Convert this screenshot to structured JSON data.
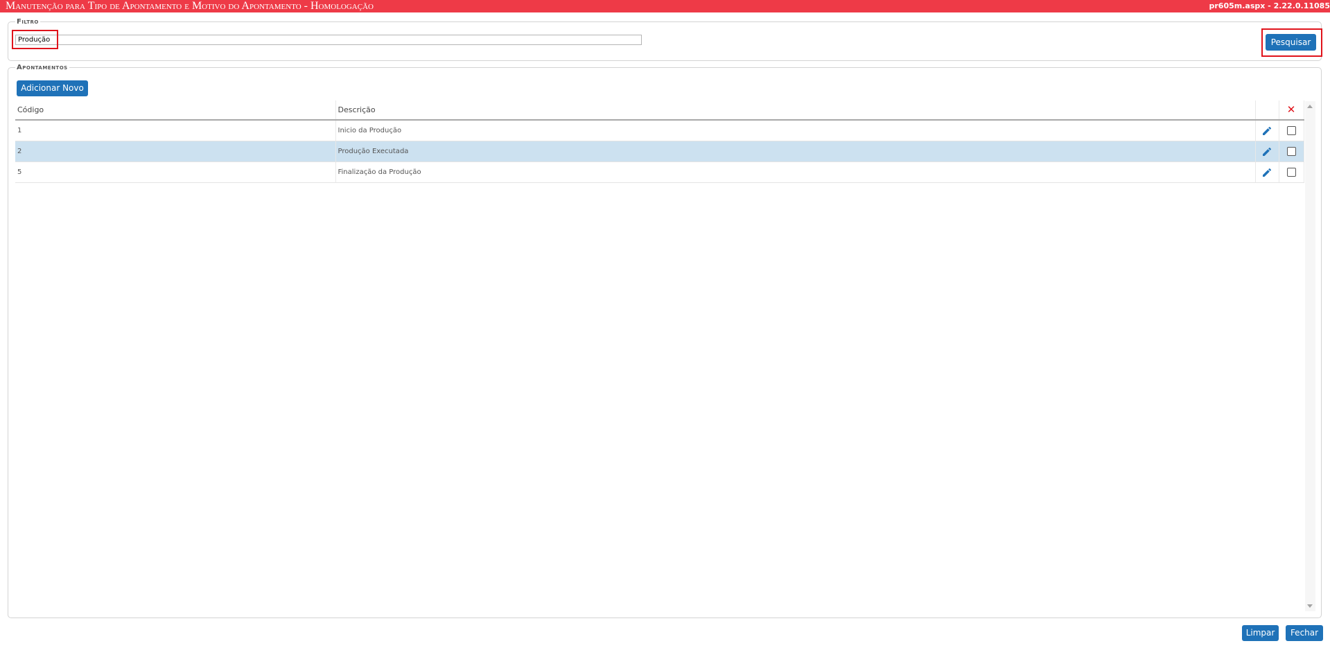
{
  "header": {
    "title": "Manutenção para Tipo de Apontamento e Motivo do Apontamento  - Homologação",
    "version": "pr605m.aspx - 2.22.0.11085"
  },
  "filter": {
    "legend": "Filtro",
    "value": "Produção",
    "search_label": "Pesquisar"
  },
  "apontamentos": {
    "legend": "Apontamentos",
    "add_label": "Adicionar Novo",
    "columns": [
      "Código",
      "Descrição"
    ],
    "rows": [
      {
        "codigo": "1",
        "descricao": "Inicio da Produção",
        "selected": false,
        "checked": false
      },
      {
        "codigo": "2",
        "descricao": "Produção Executada",
        "selected": true,
        "checked": false
      },
      {
        "codigo": "5",
        "descricao": "Finalização da Produção",
        "selected": false,
        "checked": false
      }
    ]
  },
  "footer": {
    "clear_label": "Limpar",
    "close_label": "Fechar"
  },
  "icons": {
    "edit": "pencil-icon",
    "delete": "close-x-icon"
  },
  "colors": {
    "header_bg": "#ee3a47",
    "button_bg": "#1f72b8",
    "selected_row": "#cce1f0",
    "highlight_border": "#e0131b"
  }
}
